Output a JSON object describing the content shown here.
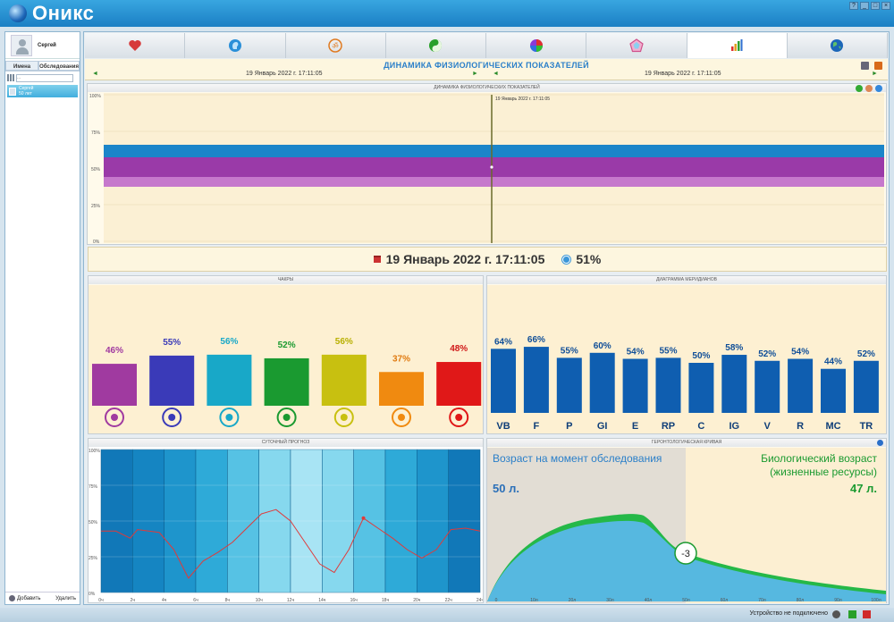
{
  "app": {
    "title": "Оникс"
  },
  "left": {
    "user_name": "Сергей",
    "tabs": [
      "Имена",
      "Обследования"
    ],
    "search_placeholder": "...",
    "patient": {
      "name": "Сергей",
      "sub": "50 лет"
    },
    "add_label": "Добавить",
    "delete_label": "Удалить"
  },
  "tabs": [
    {
      "icon": "heart-icon",
      "color": "#d63a3a"
    },
    {
      "icon": "head-profile-icon",
      "color": "#2a8fd8"
    },
    {
      "icon": "om-icon",
      "color": "#e07a20"
    },
    {
      "icon": "yin-yang-icon",
      "color": "#2aa02a"
    },
    {
      "icon": "color-wheel-icon",
      "color": "#8a3ad8"
    },
    {
      "icon": "pentagon-icon",
      "color": "#d0508a"
    },
    {
      "icon": "bar-chart-icon",
      "color": "#d6a020"
    },
    {
      "icon": "globe-icon",
      "color": "#1c66b8"
    }
  ],
  "header": {
    "title": "ДИНАМИКА ФИЗИОЛОГИЧЕСКИХ ПОКАЗАТЕЛЕЙ",
    "date_left": "19 Январь 2022 г. 17:11:05",
    "date_right": "19 Январь 2022 г. 17:11:05"
  },
  "dynamics": {
    "title": "ДИНАМИКА ФИЗИОЛОГИЧЕСКИХ ПОКАЗАТЕЛЕЙ",
    "marker_label": "19 Январь 2022 г. 17:11:05",
    "yticks": [
      "100%",
      "75%",
      "50%",
      "25%",
      "0%"
    ]
  },
  "current": {
    "date": "19 Январь 2022 г. 17:11:05",
    "percent": "51%"
  },
  "chart_data": [
    {
      "type": "bar",
      "title": "ЧАКРЫ",
      "values": [
        46,
        55,
        56,
        52,
        56,
        37,
        48
      ],
      "labels": [
        "46%",
        "55%",
        "56%",
        "52%",
        "56%",
        "37%",
        "48%"
      ],
      "colors": [
        "#a03aa0",
        "#3a3ab8",
        "#18a8c8",
        "#1a9a30",
        "#c8c010",
        "#f08a10",
        "#e01818"
      ],
      "label_colors": [
        "#a03aa0",
        "#3a3ab8",
        "#18a8c8",
        "#1a9a30",
        "#b8b000",
        "#e07a10",
        "#d01818"
      ]
    },
    {
      "type": "bar",
      "title": "ДИАГРАММА МЕРИДИАНОВ",
      "categories": [
        "VB",
        "F",
        "P",
        "GI",
        "E",
        "RP",
        "C",
        "IG",
        "V",
        "R",
        "MC",
        "TR"
      ],
      "values": [
        64,
        66,
        55,
        60,
        54,
        55,
        50,
        58,
        52,
        54,
        44,
        52
      ],
      "labels": [
        "64%",
        "66%",
        "55%",
        "60%",
        "54%",
        "55%",
        "50%",
        "58%",
        "52%",
        "54%",
        "44%",
        "52%"
      ]
    },
    {
      "type": "line",
      "title": "СУТОЧНЫЙ ПРОГНОЗ",
      "x": [
        "0ч",
        "2ч",
        "4ч",
        "6ч",
        "8ч",
        "10ч",
        "12ч",
        "14ч",
        "16ч",
        "18ч",
        "20ч",
        "22ч",
        "24ч"
      ],
      "yticks": [
        "100%",
        "75%",
        "50%",
        "25%",
        "0%"
      ],
      "ylim": [
        0,
        100
      ]
    },
    {
      "type": "area",
      "title": "ГЕРОНТОЛОГИЧЕСКАЯ КРИВАЯ",
      "x": [
        "0",
        "10л",
        "20л",
        "30л",
        "40л",
        "50л",
        "60л",
        "70л",
        "80л",
        "90л",
        "100л"
      ],
      "marker": "-3"
    }
  ],
  "gero": {
    "left_title": "Возраст на момент обследования",
    "left_value": "50 л.",
    "right_title_1": "Биологический возраст",
    "right_title_2": "(жизненные ресурсы)",
    "right_value": "47 л."
  },
  "status": {
    "text": "Устройство не подключено"
  }
}
